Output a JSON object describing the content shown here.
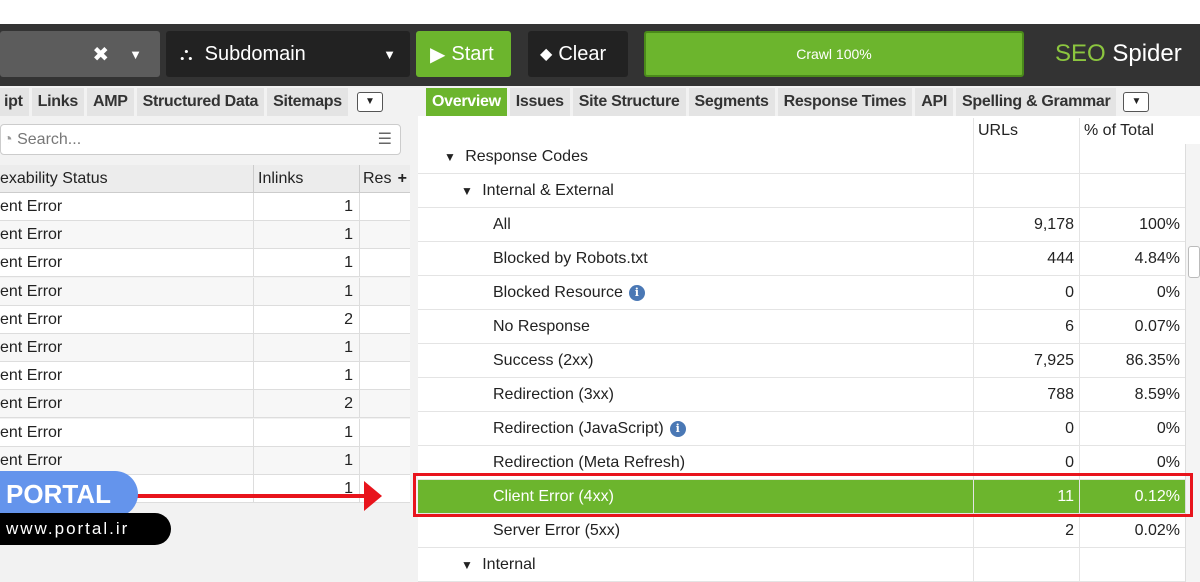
{
  "toolbar": {
    "mode": "Subdomain",
    "start": "Start",
    "clear": "Clear",
    "crawl": "Crawl 100%",
    "crawl_progress": 100,
    "brand_a": "SEO",
    "brand_b": " Spider",
    "accent": "#6cb52d"
  },
  "left_tabs": [
    "ipt",
    "Links",
    "AMP",
    "Structured Data",
    "Sitemaps"
  ],
  "right_tabs": [
    "Overview",
    "Issues",
    "Site Structure",
    "Segments",
    "Response Times",
    "API",
    "Spelling & Grammar"
  ],
  "search": {
    "placeholder": "Search..."
  },
  "left_table": {
    "headers": [
      "exability Status",
      "Inlinks",
      "Res"
    ],
    "rows": [
      [
        "ent Error",
        "1"
      ],
      [
        "ent Error",
        "1"
      ],
      [
        "ent Error",
        "1"
      ],
      [
        "ent Error",
        "1"
      ],
      [
        "ent Error",
        "2"
      ],
      [
        "ent Error",
        "1"
      ],
      [
        "ent Error",
        "1"
      ],
      [
        "ent Error",
        "2"
      ],
      [
        "ent Error",
        "1"
      ],
      [
        "ent Error",
        "1"
      ],
      [
        "",
        "1"
      ]
    ]
  },
  "right_table": {
    "headers": [
      "URLs",
      "% of Total"
    ],
    "rows": [
      {
        "label": "Response Codes",
        "level": 0,
        "expanded": true,
        "urls": "",
        "pct": ""
      },
      {
        "label": "Internal & External",
        "level": 1,
        "expanded": true,
        "urls": "",
        "pct": ""
      },
      {
        "label": "All",
        "level": 2,
        "urls": "9,178",
        "pct": "100%"
      },
      {
        "label": "Blocked by Robots.txt",
        "level": 2,
        "urls": "444",
        "pct": "4.84%"
      },
      {
        "label": "Blocked Resource",
        "level": 2,
        "info": true,
        "urls": "0",
        "pct": "0%"
      },
      {
        "label": "No Response",
        "level": 2,
        "urls": "6",
        "pct": "0.07%"
      },
      {
        "label": "Success (2xx)",
        "level": 2,
        "urls": "7,925",
        "pct": "86.35%"
      },
      {
        "label": "Redirection (3xx)",
        "level": 2,
        "urls": "788",
        "pct": "8.59%"
      },
      {
        "label": "Redirection (JavaScript)",
        "level": 2,
        "info": true,
        "urls": "0",
        "pct": "0%"
      },
      {
        "label": "Redirection (Meta Refresh)",
        "level": 2,
        "urls": "0",
        "pct": "0%"
      },
      {
        "label": "Client Error (4xx)",
        "level": 2,
        "urls": "11",
        "pct": "0.12%",
        "selected": true
      },
      {
        "label": "Server Error (5xx)",
        "level": 2,
        "urls": "2",
        "pct": "0.02%"
      },
      {
        "label": "Internal",
        "level": 1,
        "expanded": true,
        "urls": "",
        "pct": ""
      }
    ]
  },
  "watermark": {
    "name": "PORTAL",
    "url": "www.portal.ir"
  }
}
